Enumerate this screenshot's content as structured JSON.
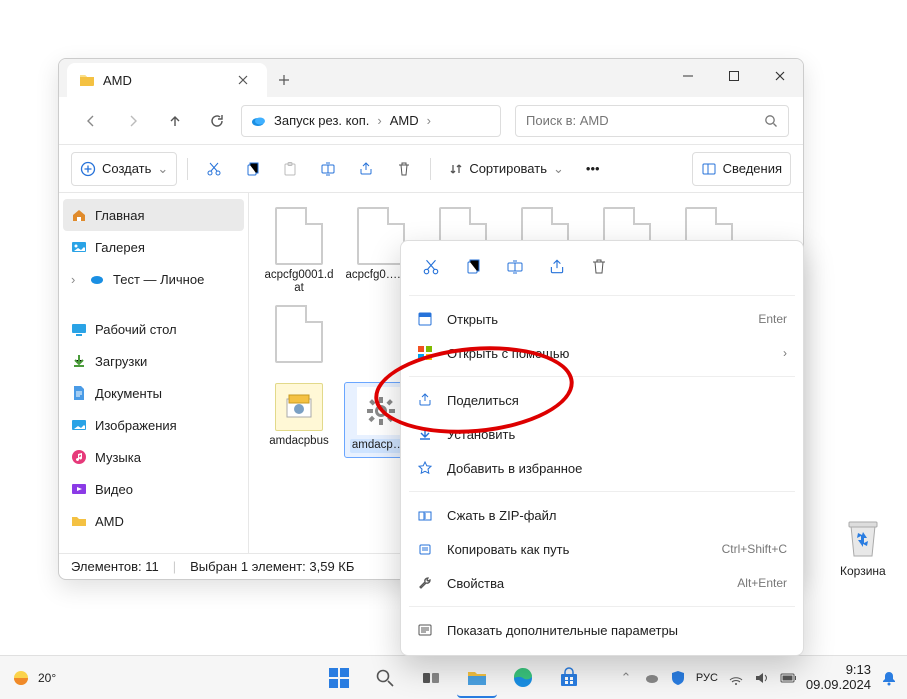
{
  "window": {
    "tab_title": "AMD"
  },
  "nav": {
    "crumbs": {
      "root": "Запуск рез. коп.",
      "leaf": "AMD"
    },
    "search_placeholder": "Поиск в: AMD"
  },
  "toolbar": {
    "create": "Создать",
    "sort": "Сортировать",
    "details": "Сведения"
  },
  "sidebar": {
    "home": "Главная",
    "gallery": "Галерея",
    "personal": "Тест — Личное",
    "desktop": "Рабочий стол",
    "downloads": "Загрузки",
    "documents": "Документы",
    "pictures": "Изображения",
    "music": "Музыка",
    "videos": "Видео",
    "amd": "AMD"
  },
  "files": {
    "f1": "acpcfg0001.dat",
    "f2": "acpcfg0….dat",
    "f3": "amdacpbus",
    "f4": "amdacp…s"
  },
  "context": {
    "open": "Открыть",
    "open_hint": "Enter",
    "open_with": "Открыть с помощью",
    "share": "Поделиться",
    "install": "Установить",
    "favorite": "Добавить в избранное",
    "zip": "Сжать в ZIP-файл",
    "copy_path": "Копировать как путь",
    "copy_path_hint": "Ctrl+Shift+C",
    "properties": "Свойства",
    "properties_hint": "Alt+Enter",
    "more": "Показать дополнительные параметры"
  },
  "status": {
    "count": "Элементов: 11",
    "selection": "Выбран 1 элемент: 3,59 КБ"
  },
  "desktop": {
    "recycle": "Корзина"
  },
  "taskbar": {
    "temp": "20°",
    "lang": "РУС",
    "time": "9:13",
    "date": "09.09.2024"
  }
}
